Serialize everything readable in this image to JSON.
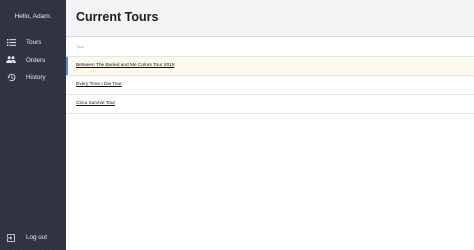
{
  "sidebar": {
    "greeting": "Hello, Adam.",
    "items": [
      {
        "label": "Tours",
        "icon": "list-icon"
      },
      {
        "label": "Orders",
        "icon": "people-icon"
      },
      {
        "label": "History",
        "icon": "history-icon"
      }
    ],
    "logout": {
      "label": "Log out",
      "icon": "logout-icon"
    }
  },
  "header": {
    "title": "Current Tours"
  },
  "table": {
    "column_header": "Tour",
    "rows": [
      "Between The Buried and Me Colors Tour 2018",
      "Every Time I Die Tour",
      "Circa Survive Tour"
    ]
  },
  "colors": {
    "sidebar_bg": "#2f3340",
    "selected_row_bg": "#fdf9ef",
    "selected_row_accent": "#4a90e2"
  }
}
